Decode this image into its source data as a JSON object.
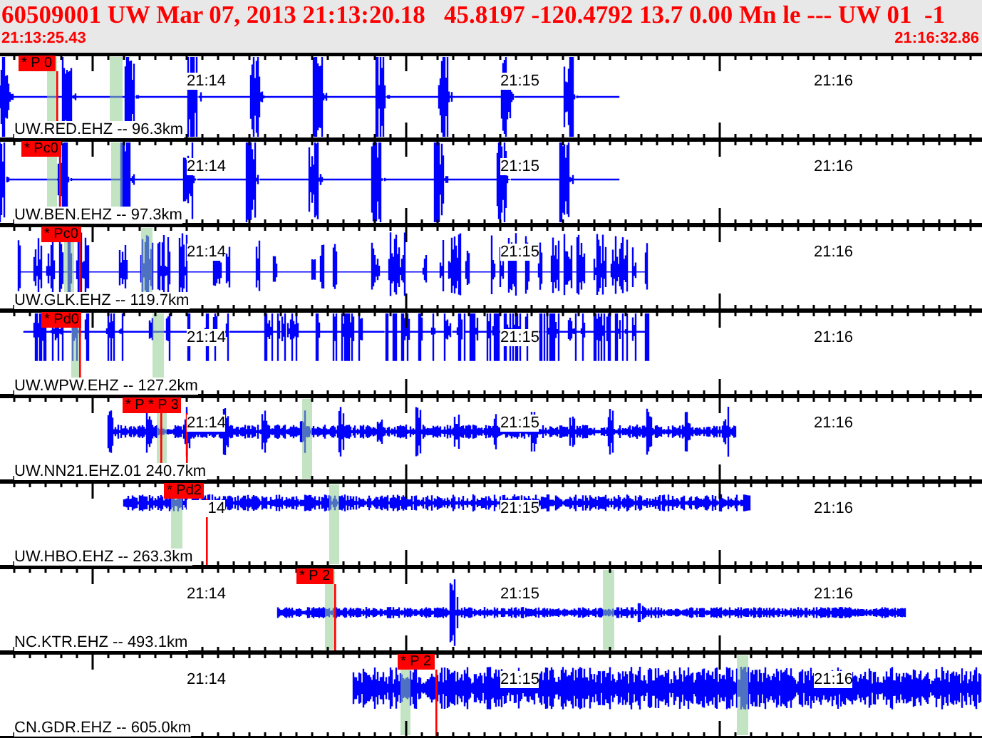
{
  "header": {
    "title": "60509001 UW Mar 07, 2013 21:13:20.18   45.8197 -120.4792 13.7 0.00 Mn le --- UW 01  -1",
    "start_time": "21:13:25.43",
    "end_time": "21:16:32.86"
  },
  "traces": [
    {
      "label": "UW.RED.EHZ -- 96.3km",
      "pick": "* P 0",
      "time_labels": [
        "21:14",
        "21:15",
        "21:16"
      ]
    },
    {
      "label": "UW.BEN.EHZ -- 97.3km",
      "pick": "* Pc0",
      "time_labels": [
        "21:14",
        "21:15",
        "21:16"
      ]
    },
    {
      "label": "UW.GLK.EHZ -- 119.7km",
      "pick": "* Pc0",
      "time_labels": [
        "21:14",
        "21:15",
        "21:16"
      ]
    },
    {
      "label": "UW.WPW.EHZ -- 127.2km",
      "pick": "* Pd0",
      "time_labels": [
        "21:14",
        "21:15",
        "21:16"
      ]
    },
    {
      "label": "UW.NN21.EHZ.01 240.7km",
      "pick": "* P * P 3",
      "time_labels": [
        "21:14",
        "21:15",
        "21:16"
      ]
    },
    {
      "label": "UW.HBO.EHZ -- 263.3km",
      "pick": "* Pd2",
      "time_labels": [
        "14",
        "21:15",
        "21:16"
      ]
    },
    {
      "label": "NC.KTR.EHZ -- 493.1km",
      "pick": "* P 2",
      "time_labels": [
        "21:14",
        "21:15",
        "21:16"
      ]
    },
    {
      "label": "CN.GDR.EHZ -- 605.0km",
      "pick": "* P 2",
      "time_labels": [
        "21:14",
        "21:15",
        "21:16"
      ]
    }
  ]
}
